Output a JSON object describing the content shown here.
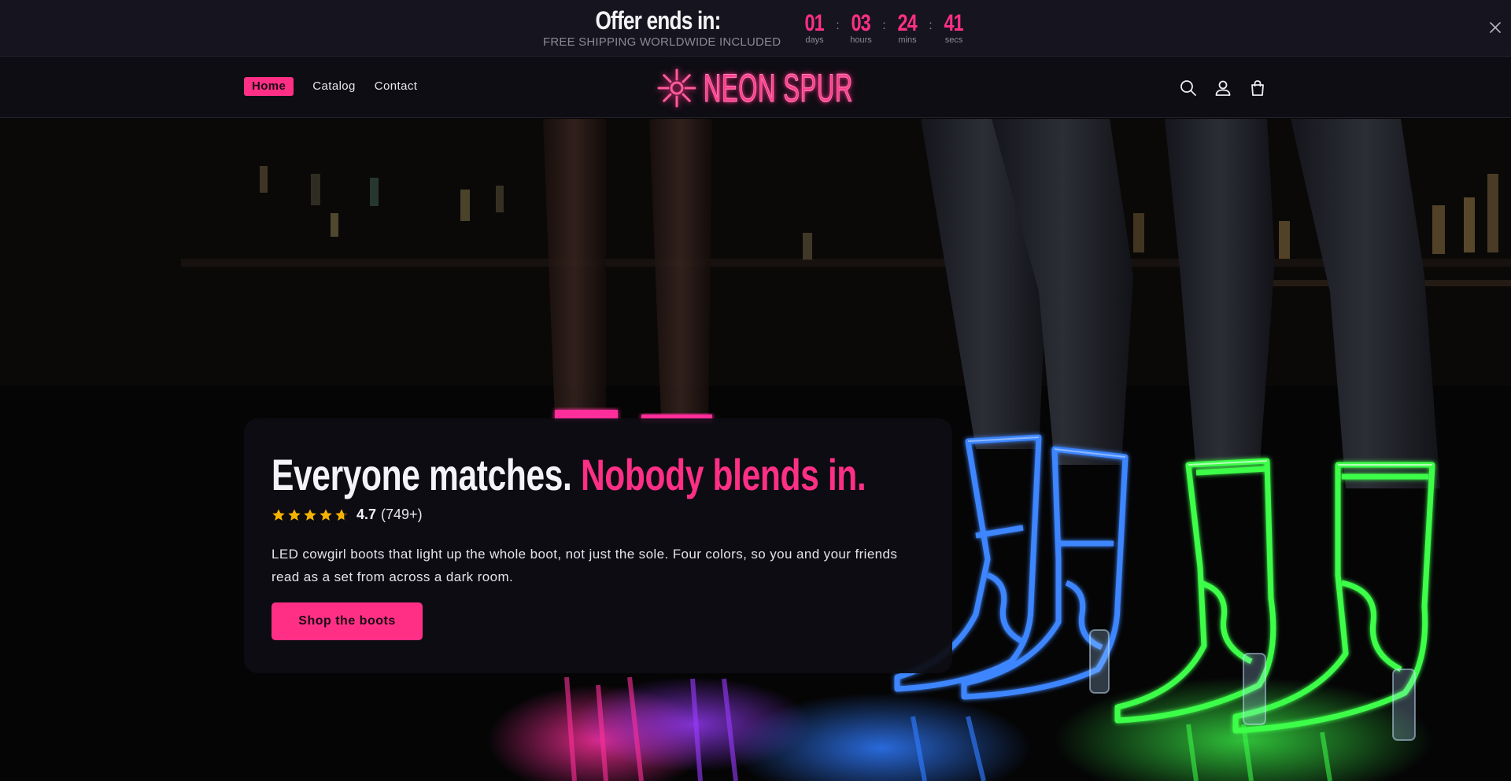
{
  "announcement": {
    "offer_title": "Offer ends in:",
    "offer_subtitle": "FREE SHIPPING WORLDWIDE INCLUDED",
    "countdown": [
      {
        "value": "01",
        "label": "days"
      },
      {
        "value": "03",
        "label": "hours"
      },
      {
        "value": "24",
        "label": "mins"
      },
      {
        "value": "41",
        "label": "secs"
      }
    ],
    "separator": ":",
    "close_icon": "close-icon"
  },
  "header": {
    "nav": [
      {
        "label": "Home",
        "active": true
      },
      {
        "label": "Catalog",
        "active": false
      },
      {
        "label": "Contact",
        "active": false
      }
    ],
    "logo_text": "NEON SPUR",
    "icons": [
      "search-icon",
      "account-icon",
      "cart-icon"
    ]
  },
  "hero": {
    "heading_white": "Everyone matches.",
    "heading_pink": "Nobody blends in.",
    "rating_value": "4.7",
    "rating_count": "(749+)",
    "rating_stars": 4.7,
    "description": "LED cowgirl boots that light up the whole boot, not just the sole. Four colors, so you and your friends read as a set from across a dark room.",
    "cta_label": "Shop the boots"
  },
  "colors": {
    "accent": "#ff2f86",
    "announce_bg": "#16151f",
    "header_bg": "#0e0d13",
    "star": "#f5b301",
    "neon_blue": "#2f7bff",
    "neon_green": "#3dff4a",
    "neon_pink": "#ff2f9a",
    "neon_purple": "#9a3bff"
  }
}
